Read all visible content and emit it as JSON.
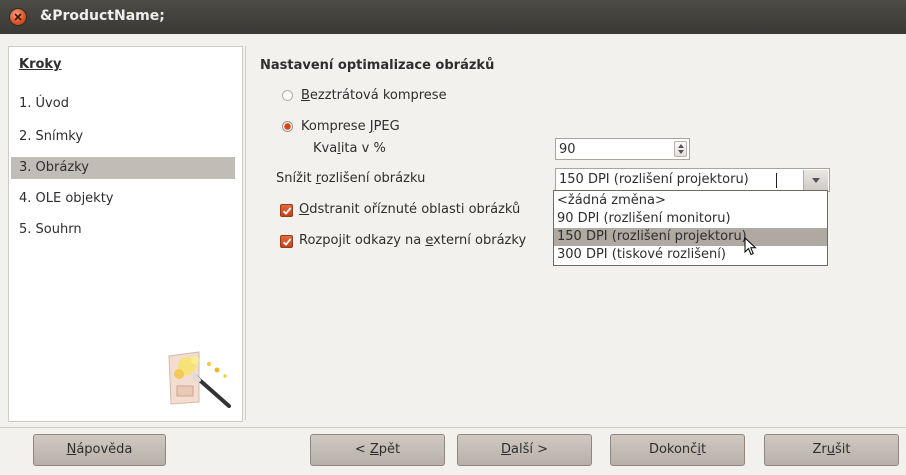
{
  "window": {
    "title": "&ProductName;"
  },
  "sidebar": {
    "heading": "Kroky",
    "steps": [
      {
        "label": "1. Úvod",
        "active": false
      },
      {
        "label": "2. Snímky",
        "active": false
      },
      {
        "label": "3. Obrázky",
        "active": true
      },
      {
        "label": "4. OLE objekty",
        "active": false
      },
      {
        "label": "5. Souhrn",
        "active": false
      }
    ]
  },
  "panel": {
    "title": "Nastavení optimalizace obrázků",
    "lossless": {
      "pre": "",
      "key": "B",
      "post": "ezztrátová komprese",
      "selected": false
    },
    "jpeg": {
      "pre": "Komprese ",
      "key": "J",
      "post": "PEG",
      "selected": true
    },
    "quality": {
      "pre": "Kva",
      "key": "l",
      "post": "ita v %",
      "value": "90"
    },
    "resolution": {
      "label_pre": "Snížit ",
      "label_key": "r",
      "label_post": "ozlišení obrázku",
      "value": "150 DPI (rozlišení projektoru)",
      "options": [
        {
          "label": "<žádná změna>",
          "selected": false
        },
        {
          "label": "90 DPI (rozlišení monitoru)",
          "selected": false
        },
        {
          "label": "150 DPI (rozlišení projektoru)",
          "selected": true
        },
        {
          "label": "300 DPI (tiskové rozlišení)",
          "selected": false
        }
      ]
    },
    "crop": {
      "pre": "",
      "key": "O",
      "post": "dstranit oříznuté oblasti obrázků",
      "checked": true
    },
    "unlink": {
      "pre": "Rozpo",
      "key": "j",
      "post": "it odkazy na ",
      "key2": "e",
      "post2": "xterní obrázky",
      "checked": true
    }
  },
  "buttons": {
    "help": {
      "pre": "",
      "key": "N",
      "post": "ápověda"
    },
    "back": {
      "pre": "< ",
      "key": "Z",
      "post": "pět"
    },
    "next": {
      "pre": "",
      "key": "D",
      "post": "alší >"
    },
    "finish": {
      "pre": "Dokonč",
      "key": "i",
      "post": "t"
    },
    "cancel": {
      "pre": "Zr",
      "key": "u",
      "post": "šit"
    }
  },
  "colors": {
    "accent": "#d8451a",
    "selection": "#c2bcb6",
    "titlebar": "#3c3b37"
  }
}
